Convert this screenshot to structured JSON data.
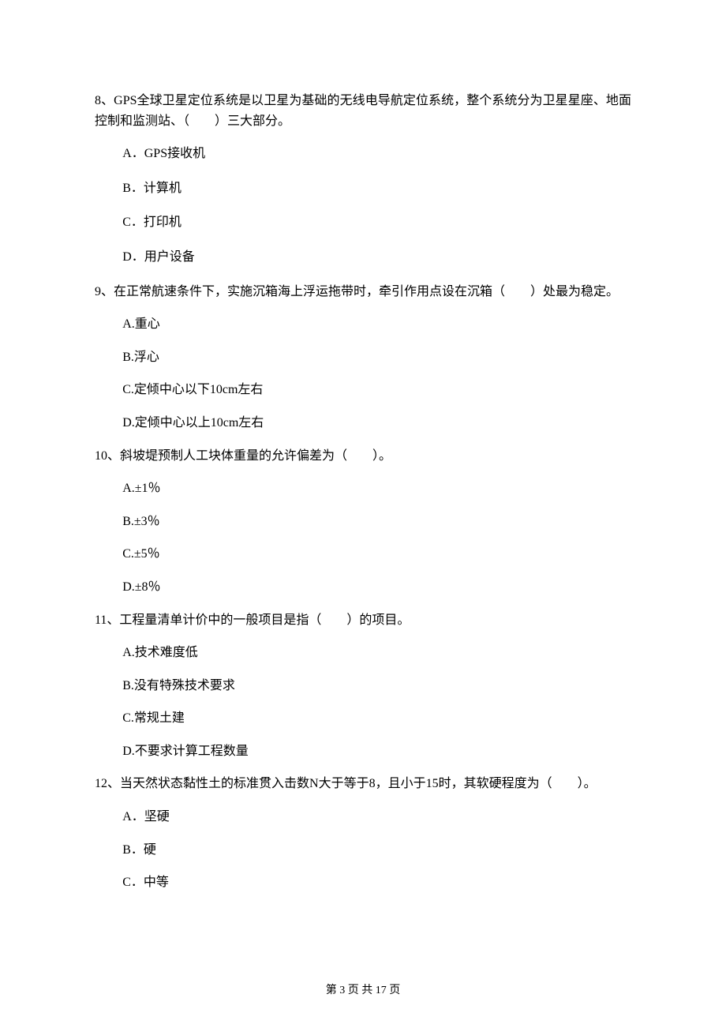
{
  "questions": [
    {
      "number": "8、",
      "stem": "GPS全球卫星定位系统是以卫星为基础的无线电导航定位系统，整个系统分为卫星星座、地面控制和监测站、（　　）三大部分。",
      "options": [
        "A．GPS接收机",
        "B．计算机",
        "C．打印机",
        "D．用户设备"
      ]
    },
    {
      "number": "9、",
      "stem": "在正常航速条件下，实施沉箱海上浮运拖带时，牵引作用点设在沉箱（　　）处最为稳定。",
      "options": [
        "A.重心",
        "B.浮心",
        "C.定倾中心以下10cm左右",
        "D.定倾中心以上10cm左右"
      ]
    },
    {
      "number": "10、",
      "stem": "斜坡堤预制人工块体重量的允许偏差为（　　）。",
      "options": [
        "A.±1％",
        "B.±3％",
        "C.±5％",
        "D.±8％"
      ]
    },
    {
      "number": "11、",
      "stem": "工程量清单计价中的一般项目是指（　　）的项目。",
      "options": [
        "A.技术难度低",
        "B.没有特殊技术要求",
        "C.常规土建",
        "D.不要求计算工程数量"
      ]
    },
    {
      "number": "12、",
      "stem": "当天然状态黏性土的标准贯入击数N大于等于8，且小于15时，其软硬程度为（　　）。",
      "options": [
        "A．坚硬",
        "B．硬",
        "C．中等"
      ]
    }
  ],
  "footer": "第 3 页 共 17 页"
}
